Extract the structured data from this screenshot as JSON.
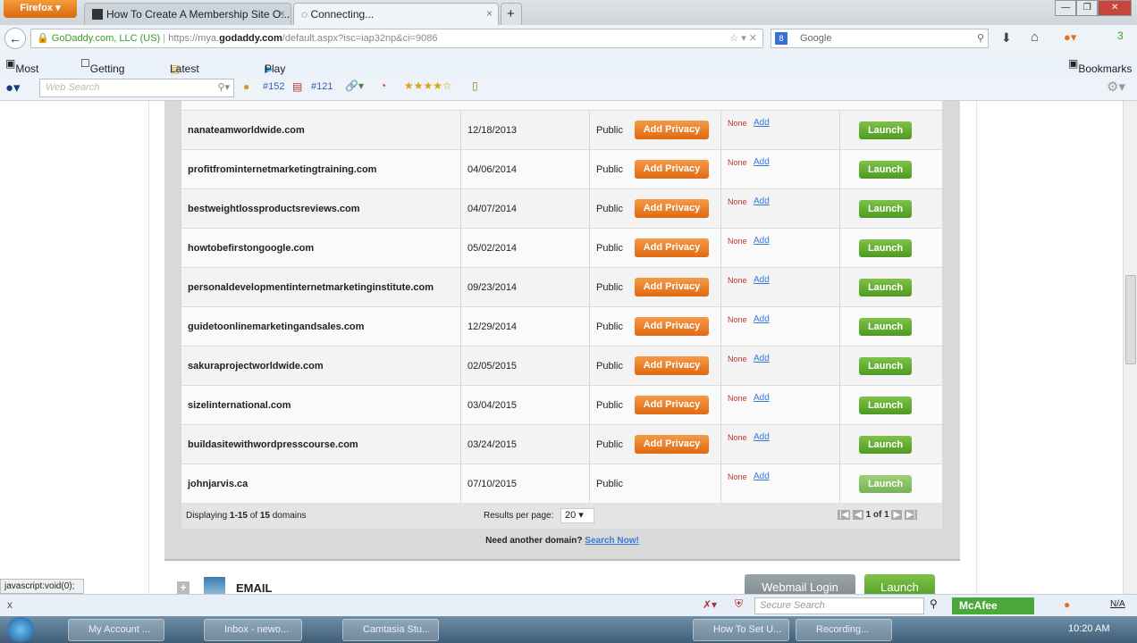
{
  "browser": {
    "menu_label": "Firefox",
    "tabs": [
      {
        "title": "How To Create A Membership Site O..."
      },
      {
        "title": "Connecting..."
      }
    ],
    "new_tab": "+",
    "site_identity": "GoDaddy.com, LLC (US)",
    "url_prefix": "https://mya.",
    "url_domain": "godaddy.com",
    "url_rest": "/default.aspx?isc=iap32np&ci=9086",
    "search_engine": "Google",
    "bookmarks": [
      "Most Visited",
      "Getting Started",
      "Latest Headlines",
      "Play"
    ],
    "bookmarks_menu": "Bookmarks",
    "toolbar": {
      "web_search_placeholder": "Web Search",
      "rank1": "#152",
      "rank2": "#121",
      "badge": "3"
    }
  },
  "domains": [
    {
      "name": "nanateamworldwide.com",
      "date": "12/18/2013",
      "privacy": "Public",
      "privacy_button": "Add Privacy",
      "forwarding": "None",
      "add": "Add",
      "launch": "Launch"
    },
    {
      "name": "profitfrominternetmarketingtraining.com",
      "date": "04/06/2014",
      "privacy": "Public",
      "privacy_button": "Add Privacy",
      "forwarding": "None",
      "add": "Add",
      "launch": "Launch"
    },
    {
      "name": "bestweightlossproductsreviews.com",
      "date": "04/07/2014",
      "privacy": "Public",
      "privacy_button": "Add Privacy",
      "forwarding": "None",
      "add": "Add",
      "launch": "Launch"
    },
    {
      "name": "howtobefirstongoogle.com",
      "date": "05/02/2014",
      "privacy": "Public",
      "privacy_button": "Add Privacy",
      "forwarding": "None",
      "add": "Add",
      "launch": "Launch"
    },
    {
      "name": "personaldevelopmentinternetmarketinginstitute.com",
      "date": "09/23/2014",
      "privacy": "Public",
      "privacy_button": "Add Privacy",
      "forwarding": "None",
      "add": "Add",
      "launch": "Launch"
    },
    {
      "name": "guidetoonlinemarketingandsales.com",
      "date": "12/29/2014",
      "privacy": "Public",
      "privacy_button": "Add Privacy",
      "forwarding": "None",
      "add": "Add",
      "launch": "Launch"
    },
    {
      "name": "sakuraprojectworldwide.com",
      "date": "02/05/2015",
      "privacy": "Public",
      "privacy_button": "Add Privacy",
      "forwarding": "None",
      "add": "Add",
      "launch": "Launch"
    },
    {
      "name": "sizelinternational.com",
      "date": "03/04/2015",
      "privacy": "Public",
      "privacy_button": "Add Privacy",
      "forwarding": "None",
      "add": "Add",
      "launch": "Launch"
    },
    {
      "name": "buildasitewithwordpresscourse.com",
      "date": "03/24/2015",
      "privacy": "Public",
      "privacy_button": "Add Privacy",
      "forwarding": "None",
      "add": "Add",
      "launch": "Launch"
    },
    {
      "name": "johnjarvis.ca",
      "date": "07/10/2015",
      "privacy": "Public",
      "privacy_button": null,
      "forwarding": "None",
      "add": "Add",
      "launch": "Launch"
    }
  ],
  "footer": {
    "displaying_prefix": "Displaying ",
    "range": "1-15",
    "of": " of ",
    "total": "15",
    "suffix": " domains",
    "results_label": "Results per page:",
    "per_page": "20",
    "page_info": "1 of 1"
  },
  "need_domain": {
    "text": "Need another domain?",
    "link": "Search Now!"
  },
  "email": {
    "title": "EMAIL",
    "webmail": "Webmail Login",
    "launch": "Launch"
  },
  "status_text": "javascript:void(0);",
  "findbar": {
    "close": "x",
    "secure_search_placeholder": "Secure Search",
    "mcafee": "McAfee",
    "na": "N/A"
  },
  "taskbar": {
    "items": [
      "My Account ...",
      "Inbox - newo...",
      "Camtasia Stu...",
      "How To Set U...",
      "Recording..."
    ],
    "clock": "10:20 AM"
  }
}
